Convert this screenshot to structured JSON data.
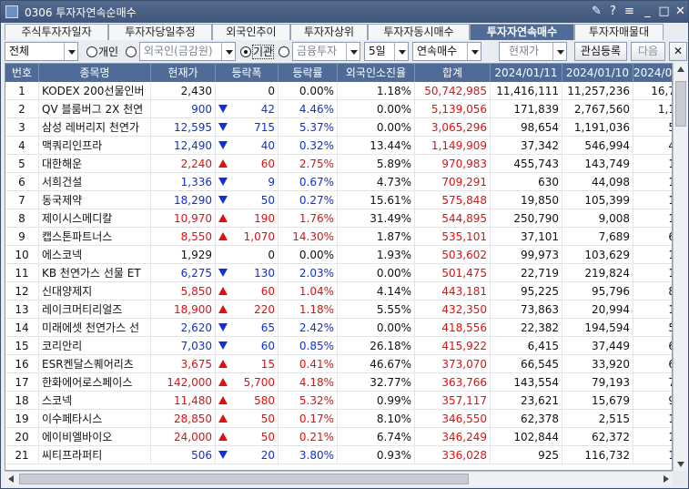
{
  "window": {
    "title": "0306 투자자연속순매수"
  },
  "tabs": [
    "주식투자자일자",
    "투자자당일추정",
    "외국인추이",
    "투자자상위",
    "투자자동시매수",
    "투자자연속매수",
    "투자자매물대"
  ],
  "active_tab": 5,
  "filters": {
    "market": "전체",
    "radio_individual": "개인",
    "radio_foreign": "외국인(금감원)",
    "radio_institution": "기관",
    "institution_type": "금융투자",
    "days": "5일",
    "mode": "연속매수",
    "price_type": "현재가",
    "watchlist_button": "관심등록",
    "next_button": "다음"
  },
  "colors": {
    "header_bg": "#4f6b97",
    "up": "#e01010",
    "down": "#1030d8"
  },
  "columns": [
    "번호",
    "종목명",
    "현재가",
    "등락폭",
    "등락률",
    "외국인소진율",
    "합계",
    "2024/01/11",
    "2024/01/10",
    "2024/01"
  ],
  "rows": [
    {
      "no": "1",
      "name": "KODEX 200선물인버",
      "price": "2,430",
      "dir": "none",
      "change": "0",
      "rate": "0.00%",
      "foreign": "1.18%",
      "total": "50,742,985",
      "d1": "11,416,111",
      "d2": "11,257,236",
      "d3": "16,7"
    },
    {
      "no": "2",
      "name": "QV 블룸버그 2X 천연",
      "price": "900",
      "dir": "down",
      "change": "42",
      "rate": "4.46%",
      "foreign": "0.00%",
      "total": "5,139,056",
      "d1": "171,839",
      "d2": "2,767,560",
      "d3": "1,1"
    },
    {
      "no": "3",
      "name": "삼성 레버리지 천연가",
      "price": "12,595",
      "dir": "down",
      "change": "715",
      "rate": "5.37%",
      "foreign": "0.00%",
      "total": "3,065,296",
      "d1": "98,654",
      "d2": "1,191,036",
      "d3": "5"
    },
    {
      "no": "4",
      "name": "맥쿼리인프라",
      "price": "12,490",
      "dir": "down",
      "change": "40",
      "rate": "0.32%",
      "foreign": "13.44%",
      "total": "1,149,909",
      "d1": "37,342",
      "d2": "546,994",
      "d3": "4"
    },
    {
      "no": "5",
      "name": "대한해운",
      "price": "2,240",
      "dir": "up",
      "change": "60",
      "rate": "2.75%",
      "foreign": "5.89%",
      "total": "970,983",
      "d1": "455,743",
      "d2": "143,749",
      "d3": "1"
    },
    {
      "no": "6",
      "name": "서희건설",
      "price": "1,336",
      "dir": "down",
      "change": "9",
      "rate": "0.67%",
      "foreign": "4.73%",
      "total": "709,291",
      "d1": "630",
      "d2": "44,098",
      "d3": "1"
    },
    {
      "no": "7",
      "name": "동국제약",
      "price": "18,290",
      "dir": "down",
      "change": "50",
      "rate": "0.27%",
      "foreign": "15.61%",
      "total": "575,848",
      "d1": "19,850",
      "d2": "105,399",
      "d3": "1"
    },
    {
      "no": "8",
      "name": "제이시스메디칼",
      "price": "10,970",
      "dir": "up",
      "change": "190",
      "rate": "1.76%",
      "foreign": "31.49%",
      "total": "544,895",
      "d1": "250,790",
      "d2": "9,008",
      "d3": "1"
    },
    {
      "no": "9",
      "name": "캡스톤파트너스",
      "price": "8,550",
      "dir": "up",
      "change": "1,070",
      "rate": "14.30%",
      "foreign": "1.87%",
      "total": "535,101",
      "d1": "37,101",
      "d2": "7,689",
      "d3": "6"
    },
    {
      "no": "10",
      "name": "에스코넥",
      "price": "1,929",
      "dir": "none",
      "change": "0",
      "rate": "0.00%",
      "foreign": "1.93%",
      "total": "503,602",
      "d1": "99,973",
      "d2": "103,629",
      "d3": "1"
    },
    {
      "no": "11",
      "name": "KB 천연가스 선물 ET",
      "price": "6,275",
      "dir": "down",
      "change": "130",
      "rate": "2.03%",
      "foreign": "0.00%",
      "total": "501,475",
      "d1": "22,719",
      "d2": "219,824",
      "d3": "1"
    },
    {
      "no": "12",
      "name": "신대양제지",
      "price": "5,850",
      "dir": "up",
      "change": "60",
      "rate": "1.04%",
      "foreign": "4.14%",
      "total": "443,181",
      "d1": "95,225",
      "d2": "95,796",
      "d3": "8"
    },
    {
      "no": "13",
      "name": "레이크머티리얼즈",
      "price": "18,900",
      "dir": "up",
      "change": "220",
      "rate": "1.18%",
      "foreign": "5.55%",
      "total": "432,350",
      "d1": "73,863",
      "d2": "20,994",
      "d3": "1"
    },
    {
      "no": "14",
      "name": "미래에셋 천연가스 선",
      "price": "2,620",
      "dir": "down",
      "change": "65",
      "rate": "2.42%",
      "foreign": "0.00%",
      "total": "418,556",
      "d1": "22,382",
      "d2": "194,594",
      "d3": "5"
    },
    {
      "no": "15",
      "name": "코리안리",
      "price": "7,030",
      "dir": "down",
      "change": "60",
      "rate": "0.85%",
      "foreign": "26.18%",
      "total": "415,922",
      "d1": "6,415",
      "d2": "37,449",
      "d3": "6"
    },
    {
      "no": "16",
      "name": "ESR켄달스퀘어리츠",
      "price": "3,675",
      "dir": "up",
      "change": "15",
      "rate": "0.41%",
      "foreign": "46.67%",
      "total": "373,070",
      "d1": "66,545",
      "d2": "33,920",
      "d3": "6"
    },
    {
      "no": "17",
      "name": "한화에어로스페이스",
      "price": "142,000",
      "dir": "up",
      "change": "5,700",
      "rate": "4.18%",
      "foreign": "32.77%",
      "total": "363,766",
      "d1": "143,554",
      "d2": "79,193",
      "d3": "7"
    },
    {
      "no": "18",
      "name": "스코넥",
      "price": "11,480",
      "dir": "up",
      "change": "580",
      "rate": "5.32%",
      "foreign": "0.99%",
      "total": "357,117",
      "d1": "23,621",
      "d2": "15,679",
      "d3": "9"
    },
    {
      "no": "19",
      "name": "이수페타시스",
      "price": "28,850",
      "dir": "up",
      "change": "50",
      "rate": "0.17%",
      "foreign": "8.10%",
      "total": "346,550",
      "d1": "62,378",
      "d2": "2,515",
      "d3": "1"
    },
    {
      "no": "20",
      "name": "에이비엘바이오",
      "price": "24,000",
      "dir": "up",
      "change": "50",
      "rate": "0.21%",
      "foreign": "6.74%",
      "total": "346,249",
      "d1": "102,844",
      "d2": "62,372",
      "d3": "1"
    },
    {
      "no": "21",
      "name": "씨티프라퍼티",
      "price": "506",
      "dir": "down",
      "change": "20",
      "rate": "3.80%",
      "foreign": "0.93%",
      "total": "336,028",
      "d1": "925",
      "d2": "116,732",
      "d3": "1"
    }
  ]
}
